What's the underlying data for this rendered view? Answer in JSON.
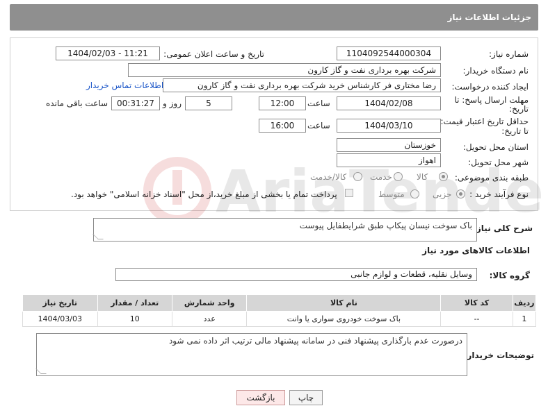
{
  "header": {
    "title": "جزئیات اطلاعات نیاز"
  },
  "fields": {
    "need_number": {
      "label": "شماره نیاز:",
      "value": "1104092544000304"
    },
    "announce_datetime": {
      "label": "تاریخ و ساعت اعلان عمومی:",
      "value": "1404/02/03 - 11:21"
    },
    "buyer_org": {
      "label": "نام دستگاه خریدار:",
      "value": "شرکت بهره برداری نفت و گاز کارون"
    },
    "requester": {
      "label": "ایجاد کننده درخواست:",
      "value": "رضا مختاری فر کارشناس خرید شرکت بهره برداری نفت و گاز کارون"
    },
    "buyer_contact_link": "اطلاعات تماس خریدار",
    "deadline": {
      "label_line1": "مهلت ارسال پاسخ: تا",
      "label_line2": "تاریخ:",
      "date": "1404/02/08",
      "time_label": "ساعت",
      "time": "12:00",
      "days": "5",
      "days_label": "روز و",
      "remaining": "00:31:27",
      "remaining_label": "ساعت باقی مانده"
    },
    "validity": {
      "label_line1": "حداقل تاریخ اعتبار قیمت:",
      "label_line2": "تا تاریخ:",
      "date": "1404/03/10",
      "time_label": "ساعت",
      "time": "16:00"
    },
    "province": {
      "label": "استان محل تحویل:",
      "value": "خوزستان"
    },
    "city": {
      "label": "شهر محل تحویل:",
      "value": "اهواز"
    },
    "category": {
      "label": "طبقه بندی موضوعی:",
      "options": [
        "کالا",
        "خدمت",
        "کالا/خدمت"
      ],
      "selected": "کالا"
    },
    "process": {
      "label": "نوع فرآیند خرید :",
      "options": [
        "جزیی",
        "متوسط"
      ],
      "selected": "جزیی",
      "payment_note": "پرداخت تمام یا بخشی از مبلغ خرید،از محل \"اسناد خزانه اسلامی\" خواهد بود."
    }
  },
  "description": {
    "label": "شرح کلی نیاز:",
    "value": "باک سوخت نیسان پیکاپ طبق شرایطفایل پیوست"
  },
  "goods_section_title": "اطلاعات کالاهای مورد نیاز",
  "goods_group": {
    "label": "گروه کالا:",
    "value": "وسایل نقلیه، قطعات و لوازم جانبی"
  },
  "table": {
    "headers": [
      "ردیف",
      "کد کالا",
      "نام کالا",
      "واحد شمارش",
      "تعداد / مقدار",
      "تاریخ نیاز"
    ],
    "rows": [
      [
        "1",
        "--",
        "باک سوخت خودروی سواری یا وانت",
        "عدد",
        "10",
        "1404/03/03"
      ]
    ]
  },
  "buyer_notes": {
    "label": "توضیحات خریدار:",
    "value": "درصورت عدم بارگذاری پیشنهاد فنی در سامانه پیشنهاد مالی ترتیب اثر داده نمی شود"
  },
  "buttons": {
    "print": "چاپ",
    "back": "بازگشت"
  },
  "watermark_text": "AriaTender.neT",
  "colors": {
    "header_bg": "#8f8f8f",
    "link": "#1a55c8",
    "table_header": "#d6d6d6",
    "back_button": "#fde8e8"
  }
}
